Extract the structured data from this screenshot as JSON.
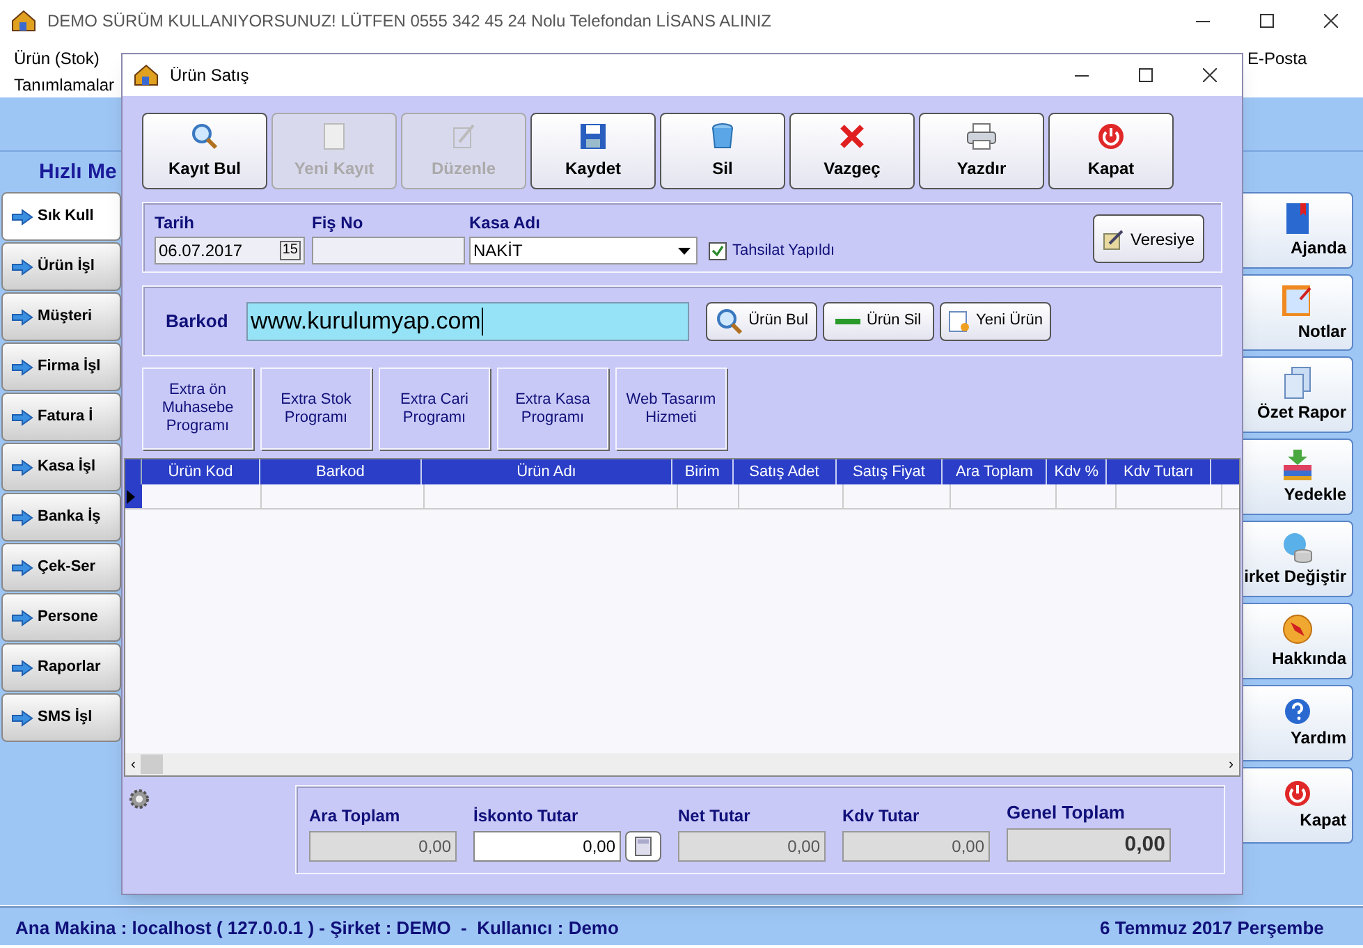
{
  "window": {
    "title": "DEMO SÜRÜM KULLANIYORSUNUZ! LÜTFEN 0555 342 45 24 Nolu Telefondan LİSANS ALINIZ"
  },
  "menu": {
    "row_1": [
      "Ürün (Stok)",
      "E-Posta"
    ],
    "row_2": [
      "Tanımlamalar"
    ]
  },
  "sidebar": {
    "title": "Hızlı Me",
    "items": [
      {
        "label": "Sık Kull",
        "selected": true
      },
      {
        "label": "Ürün İşl",
        "selected": false
      },
      {
        "label": "Müşteri",
        "selected": false
      },
      {
        "label": "Firma İşl",
        "selected": false
      },
      {
        "label": "Fatura İ",
        "selected": false
      },
      {
        "label": "Kasa İşl",
        "selected": false
      },
      {
        "label": "Banka İş",
        "selected": false
      },
      {
        "label": "Çek-Ser",
        "selected": false
      },
      {
        "label": "Persone",
        "selected": false
      },
      {
        "label": "Raporlar",
        "selected": false
      },
      {
        "label": "SMS İşl",
        "selected": false
      }
    ]
  },
  "right_panel": [
    {
      "label": "Ajanda",
      "kind": "book"
    },
    {
      "label": "Notlar",
      "kind": "notes"
    },
    {
      "label": "Özet Rapor",
      "kind": "report"
    },
    {
      "label": "Yedekle",
      "kind": "backup"
    },
    {
      "label": "irket Değiştir",
      "kind": "database"
    },
    {
      "label": "Hakkında",
      "kind": "compass"
    },
    {
      "label": "Yardım",
      "kind": "help"
    },
    {
      "label": "Kapat",
      "kind": "power"
    }
  ],
  "dialog": {
    "title": "Ürün Satış",
    "toolbar": [
      {
        "label": "Kayıt Bul",
        "kind": "search",
        "disabled": false
      },
      {
        "label": "Yeni Kayıt",
        "kind": "page",
        "disabled": true
      },
      {
        "label": "Düzenle",
        "kind": "edit",
        "disabled": true
      },
      {
        "label": "Kaydet",
        "kind": "save",
        "disabled": false
      },
      {
        "label": "Sil",
        "kind": "trash",
        "disabled": false
      },
      {
        "label": "Vazgeç",
        "kind": "cancel",
        "disabled": false
      },
      {
        "label": "Yazdır",
        "kind": "print",
        "disabled": false
      },
      {
        "label": "Kapat",
        "kind": "power",
        "disabled": false
      }
    ],
    "date": {
      "label": "Tarih",
      "value": "06.07.2017",
      "button": "15"
    },
    "receipt_no": {
      "label": "Fiş No"
    },
    "cash": {
      "label": "Kasa Adı",
      "value": "NAKİT"
    },
    "collected": {
      "label": "Tahsilat Yapıldı",
      "checked": true
    },
    "credit_button": "Veresiye",
    "barcode": {
      "label": "Barkod",
      "value": "www.kurulumyap.com"
    },
    "product_buttons": [
      {
        "label": "Ürün Bul",
        "kind": "search"
      },
      {
        "label": "Ürün Sil",
        "kind": "minus"
      },
      {
        "label": "Yeni Ürün",
        "kind": "new"
      }
    ],
    "extra_buttons": [
      "Extra ön Muhasebe Programı",
      "Extra Stok Programı",
      "Extra Cari Programı",
      "Extra Kasa Programı",
      "Web Tasarım Hizmeti"
    ],
    "table": {
      "scroll_left": "‹",
      "scroll_right": "›",
      "columns": [
        "Ürün Kod",
        "Barkod",
        "Ürün Adı",
        "Birim",
        "Satış Adet",
        "Satış Fiyat",
        "Ara Toplam",
        "Kdv %",
        "Kdv Tutarı"
      ]
    },
    "totals": [
      {
        "label": "Ara Toplam",
        "value": "0,00",
        "kind": "readonly"
      },
      {
        "label": "İskonto Tutar",
        "value": "0,00",
        "kind": "editable"
      },
      {
        "label": "Net Tutar",
        "value": "0,00",
        "kind": "readonly"
      },
      {
        "label": "Kdv Tutar",
        "value": "0,00",
        "kind": "readonly"
      },
      {
        "label": "Genel Toplam",
        "value": "0,00",
        "kind": "grand"
      }
    ]
  },
  "status_bar": {
    "left": "Ana Makina : localhost ( 127.0.0.1 ) - Şirket : DEMO  -  Kullanıcı : Demo",
    "right": "6 Temmuz 2017 Perşembe"
  }
}
